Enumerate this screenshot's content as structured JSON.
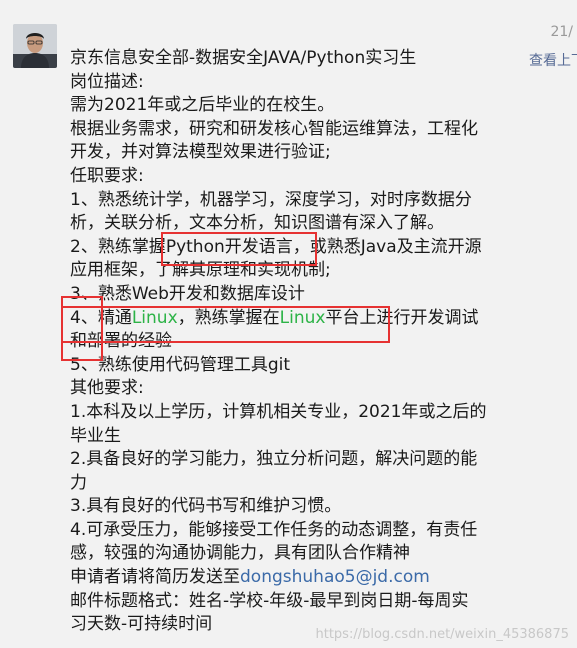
{
  "header": {
    "timestamp": "21/",
    "view_link": "查看上下"
  },
  "message": {
    "title": "京东信息安全部-数据安全JAVA/Python实习生",
    "lines": [
      "岗位描述:",
      "需为2021年或之后毕业的在校生。",
      "根据业务需求，研究和研发核心智能运维算法，工程化",
      "开发，并对算法模型效果进行验证;",
      "任职要求:",
      "1、熟悉统计学，机器学习，深度学习，对时序数据分",
      "析，关联分析，文本分析，知识图谱有深入了解。",
      "2、熟练掌握Python开发语言，或熟悉Java及主流开源",
      "应用框架，了解其原理和实现机制;",
      "3、熟悉Web开发和数据库设计"
    ],
    "line4": {
      "prefix": "4、精通",
      "linux1": "Linux",
      "middle": "，熟练掌握在",
      "linux2": "Linux",
      "suffix": "平台上进行开发调试"
    },
    "lines_after": [
      "和部署的经验",
      "5、熟练使用代码管理工具git",
      "其他要求:",
      "1.本科及以上学历，计算机相关专业，2021年或之后的",
      "毕业生",
      "2.具备良好的学习能力，独立分析问题，解决问题的能",
      "力",
      "3.具有良好的代码书写和维护习惯。",
      "4.可承受压力，能够接受工作任务的动态调整，有责任",
      "感，较强的沟通协调能力，具有团队合作精神"
    ],
    "apply_prefix": "申请者请将简历发送至",
    "email": "dongshuhao5@jd.com",
    "subject_lines": [
      "邮件标题格式：姓名-学校-年级-最早到岗日期-每周实",
      "习天数-可持续时间"
    ]
  },
  "watermark": "https://blog.csdn.net/weixin_45386875",
  "colors": {
    "link": "#576b95",
    "linux_highlight": "#2db347",
    "email": "#3b6aa8",
    "annotation_box": "#e63232"
  }
}
